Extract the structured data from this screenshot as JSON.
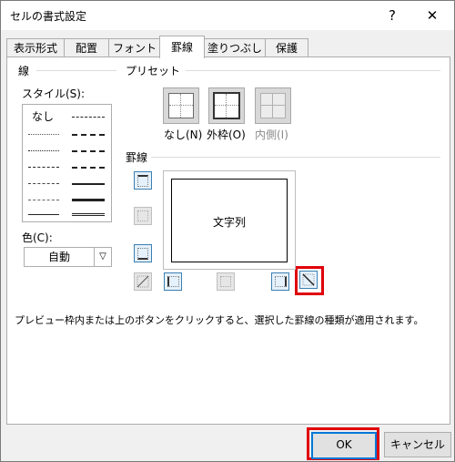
{
  "window": {
    "title": "セルの書式設定",
    "help_glyph": "?",
    "close_glyph": "✕"
  },
  "tabs": [
    {
      "label": "表示形式"
    },
    {
      "label": "配置"
    },
    {
      "label": "フォント"
    },
    {
      "label": "罫線",
      "active": true
    },
    {
      "label": "塗りつぶし"
    },
    {
      "label": "保護"
    }
  ],
  "line_section": {
    "title": "線",
    "style_label": "スタイル(S):",
    "none_label": "なし",
    "color_label": "色(C):",
    "color_value": "自動",
    "dropdown_glyph": "▽"
  },
  "preset_section": {
    "title": "プリセット",
    "none_label": "なし(N)",
    "outline_label": "外枠(O)",
    "inside_label": "内側(I)"
  },
  "border_section": {
    "title": "罫線",
    "preview_text": "文字列"
  },
  "hint_text": "プレビュー枠内または上のボタンをクリックすると、選択した罫線の種類が適用されます。",
  "buttons": {
    "ok": "OK",
    "cancel": "キャンセル"
  },
  "colors": {
    "highlight": "#e0000a",
    "accent": "#0078d7"
  }
}
